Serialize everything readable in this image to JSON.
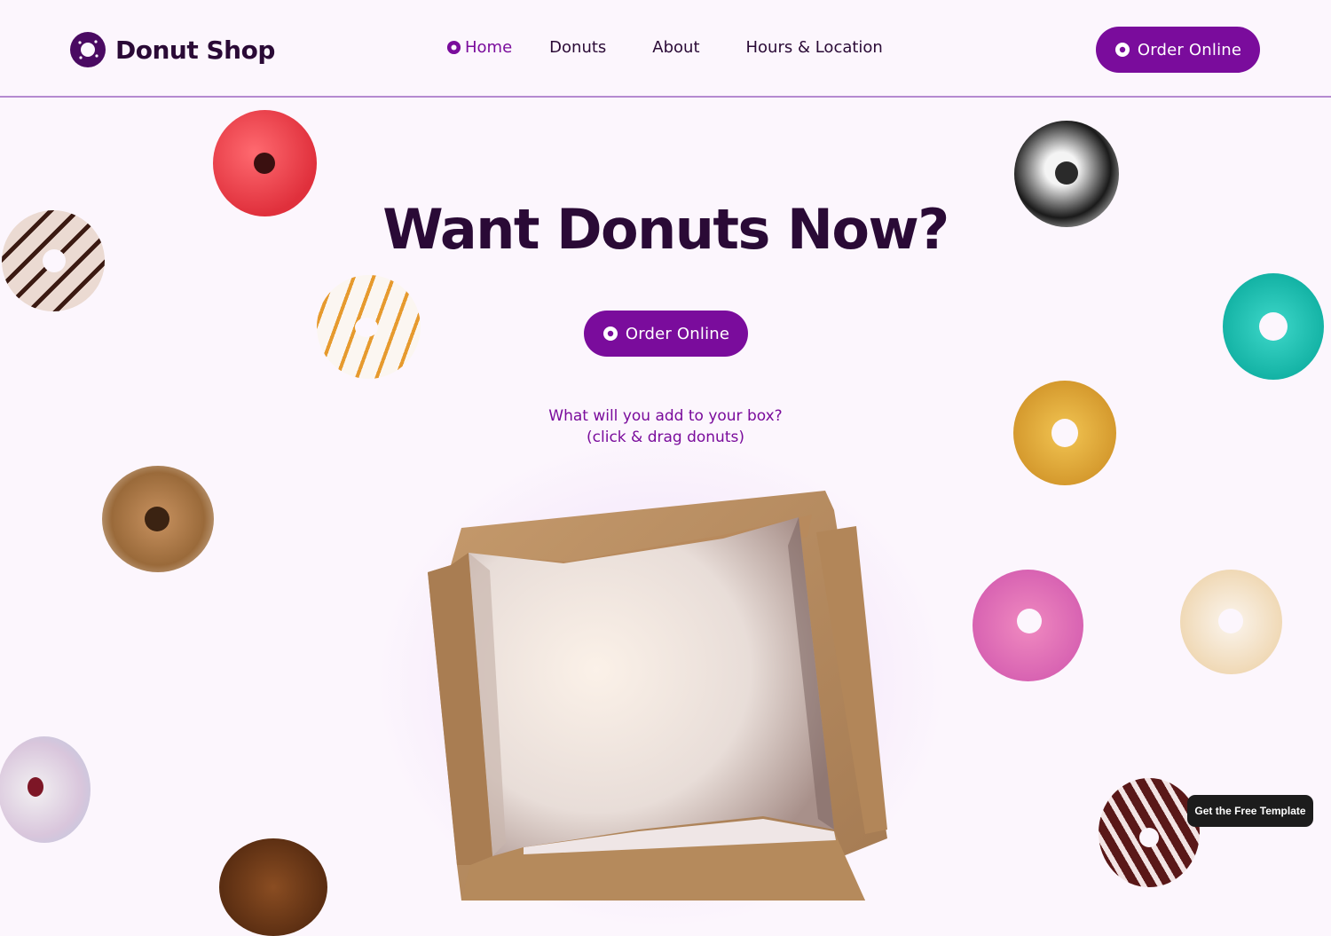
{
  "header": {
    "logo_text": "Donut Shop",
    "nav": [
      {
        "label": "Home",
        "active": true
      },
      {
        "label": "Donuts"
      },
      {
        "label": "About"
      },
      {
        "label": "Hours & Location"
      }
    ],
    "order_label": "Order Online"
  },
  "hero": {
    "title": "Want Donuts Now?",
    "order_label": "Order Online",
    "prompt_line1": "What will you add to your box?",
    "prompt_line2": "(click & drag donuts)"
  },
  "badge": {
    "label": "Get the Free Template"
  },
  "colors": {
    "brand": "#7a0c9c",
    "text": "#2a0a36",
    "background": "#fcf6fd",
    "divider": "#b58ad0"
  },
  "donuts": [
    {
      "name": "red-sprinkle-donut"
    },
    {
      "name": "chocolate-stripe-donut"
    },
    {
      "name": "orange-stripe-donut"
    },
    {
      "name": "caramel-nut-donut"
    },
    {
      "name": "rainbow-sprinkle-donut"
    },
    {
      "name": "chocolate-donut"
    },
    {
      "name": "cookies-cream-donut"
    },
    {
      "name": "teal-sprinkle-donut"
    },
    {
      "name": "yellow-sprinkle-donut"
    },
    {
      "name": "pink-sprinkle-donut"
    },
    {
      "name": "white-sprinkle-donut"
    },
    {
      "name": "zebra-chocolate-donut"
    }
  ]
}
